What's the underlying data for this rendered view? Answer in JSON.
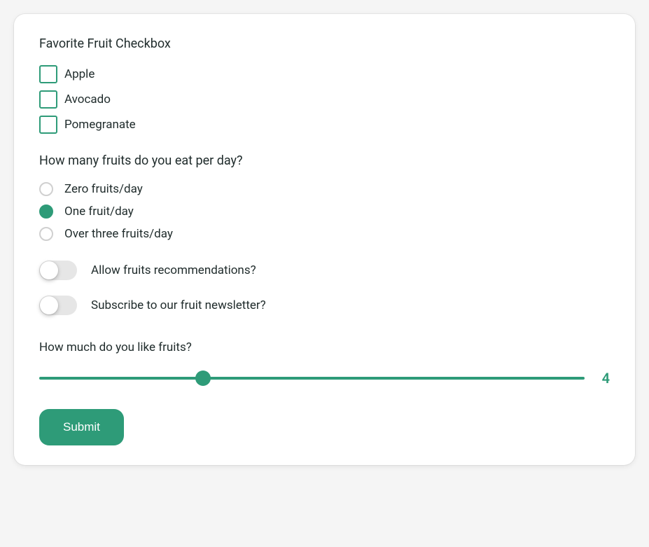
{
  "checkbox_section": {
    "title": "Favorite Fruit Checkbox",
    "options": [
      {
        "label": "Apple",
        "checked": false
      },
      {
        "label": "Avocado",
        "checked": false
      },
      {
        "label": "Pomegranate",
        "checked": false
      }
    ]
  },
  "radio_section": {
    "title": "How many fruits do you eat per day?",
    "options": [
      {
        "label": "Zero fruits/day",
        "selected": false
      },
      {
        "label": "One fruit/day",
        "selected": true
      },
      {
        "label": "Over three fruits/day",
        "selected": false
      }
    ]
  },
  "toggles": [
    {
      "label": "Allow fruits recommendations?",
      "on": false
    },
    {
      "label": "Subscribe to our fruit newsletter?",
      "on": false
    }
  ],
  "slider": {
    "title": "How much do you like fruits?",
    "value": 4,
    "min": 0,
    "max": 10,
    "percent": 30
  },
  "submit_label": "Submit",
  "colors": {
    "accent": "#2e9b78"
  }
}
